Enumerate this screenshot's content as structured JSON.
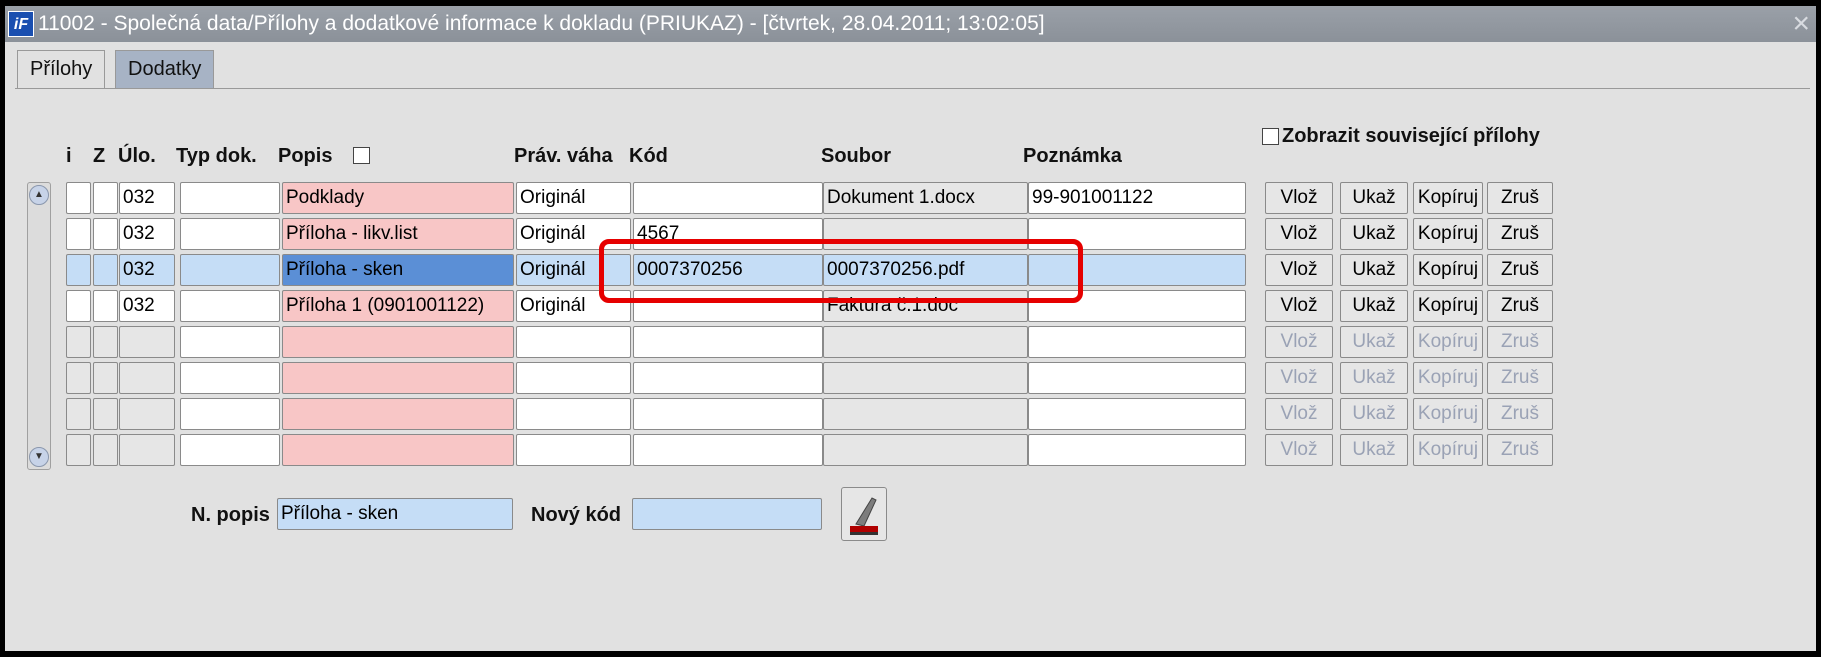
{
  "window": {
    "title": "11002 - Společná data/Přílohy a dodatkové informace k dokladu (PRIUKAZ) - [čtvrtek, 28.04.2011; 13:02:05]",
    "close_glyph": "×",
    "app_icon_text": "iF"
  },
  "tabs": [
    {
      "label": "Přílohy",
      "active": true
    },
    {
      "label": "Dodatky",
      "active": false
    }
  ],
  "headers": {
    "i": "i",
    "z": "Z",
    "ulo": "Úlo.",
    "typ": "Typ dok.",
    "popis": "Popis",
    "prav": "Práv. váha",
    "kod": "Kód",
    "soubor": "Soubor",
    "poznamka": "Poznámka",
    "related": "Zobrazit související přílohy"
  },
  "rows": [
    {
      "ulo": "032",
      "typ": "",
      "popis": "Podklady",
      "prav": "Originál",
      "kod": "",
      "soubor": "Dokument 1.docx",
      "poznamka": "99-901001122",
      "enabled": true,
      "selected": false
    },
    {
      "ulo": "032",
      "typ": "",
      "popis": "Příloha - likv.list",
      "prav": "Originál",
      "kod": "4567",
      "soubor": "",
      "poznamka": "",
      "enabled": true,
      "selected": false
    },
    {
      "ulo": "032",
      "typ": "",
      "popis": "Příloha - sken",
      "prav": "Originál",
      "kod": "0007370256",
      "soubor": "0007370256.pdf",
      "poznamka": "",
      "enabled": true,
      "selected": true
    },
    {
      "ulo": "032",
      "typ": "",
      "popis": "Příloha 1 (0901001122)",
      "prav": "Originál",
      "kod": "",
      "soubor": "Faktura č.1.doc",
      "poznamka": "",
      "enabled": true,
      "selected": false
    },
    {
      "ulo": "",
      "typ": "",
      "popis": "",
      "prav": "",
      "kod": "",
      "soubor": "",
      "poznamka": "",
      "enabled": false,
      "selected": false
    },
    {
      "ulo": "",
      "typ": "",
      "popis": "",
      "prav": "",
      "kod": "",
      "soubor": "",
      "poznamka": "",
      "enabled": false,
      "selected": false
    },
    {
      "ulo": "",
      "typ": "",
      "popis": "",
      "prav": "",
      "kod": "",
      "soubor": "",
      "poznamka": "",
      "enabled": false,
      "selected": false
    },
    {
      "ulo": "",
      "typ": "",
      "popis": "",
      "prav": "",
      "kod": "",
      "soubor": "",
      "poznamka": "",
      "enabled": false,
      "selected": false
    }
  ],
  "row_buttons": {
    "vloz": "Vlož",
    "ukaz": "Ukaž",
    "kopiruj": "Kopíruj",
    "zrus": "Zruš"
  },
  "footer": {
    "n_popis_label": "N. popis",
    "n_popis_value": "Příloha - sken",
    "novy_kod_label": "Nový kód",
    "novy_kod_value": ""
  },
  "colors": {
    "highlight": "#e60000",
    "selected_row": "#c5ddf6",
    "popis_field": "#f8c6c6"
  }
}
